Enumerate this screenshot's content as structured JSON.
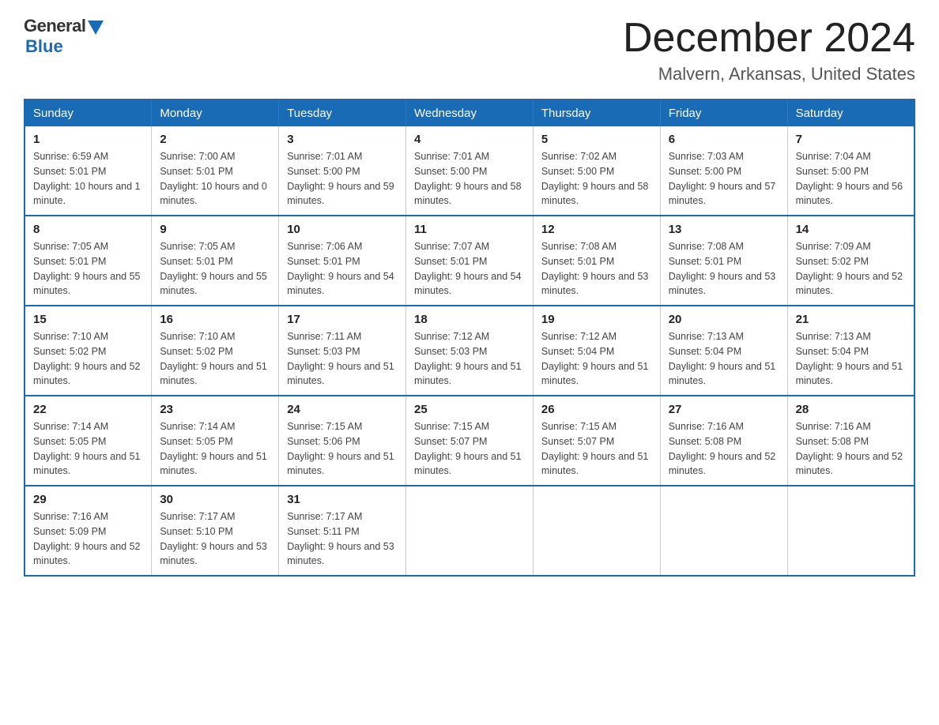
{
  "header": {
    "logo_general": "General",
    "logo_blue": "Blue",
    "month_title": "December 2024",
    "location": "Malvern, Arkansas, United States"
  },
  "days_of_week": [
    "Sunday",
    "Monday",
    "Tuesday",
    "Wednesday",
    "Thursday",
    "Friday",
    "Saturday"
  ],
  "weeks": [
    [
      {
        "day": "1",
        "sunrise": "6:59 AM",
        "sunset": "5:01 PM",
        "daylight": "10 hours and 1 minute."
      },
      {
        "day": "2",
        "sunrise": "7:00 AM",
        "sunset": "5:01 PM",
        "daylight": "10 hours and 0 minutes."
      },
      {
        "day": "3",
        "sunrise": "7:01 AM",
        "sunset": "5:00 PM",
        "daylight": "9 hours and 59 minutes."
      },
      {
        "day": "4",
        "sunrise": "7:01 AM",
        "sunset": "5:00 PM",
        "daylight": "9 hours and 58 minutes."
      },
      {
        "day": "5",
        "sunrise": "7:02 AM",
        "sunset": "5:00 PM",
        "daylight": "9 hours and 58 minutes."
      },
      {
        "day": "6",
        "sunrise": "7:03 AM",
        "sunset": "5:00 PM",
        "daylight": "9 hours and 57 minutes."
      },
      {
        "day": "7",
        "sunrise": "7:04 AM",
        "sunset": "5:00 PM",
        "daylight": "9 hours and 56 minutes."
      }
    ],
    [
      {
        "day": "8",
        "sunrise": "7:05 AM",
        "sunset": "5:01 PM",
        "daylight": "9 hours and 55 minutes."
      },
      {
        "day": "9",
        "sunrise": "7:05 AM",
        "sunset": "5:01 PM",
        "daylight": "9 hours and 55 minutes."
      },
      {
        "day": "10",
        "sunrise": "7:06 AM",
        "sunset": "5:01 PM",
        "daylight": "9 hours and 54 minutes."
      },
      {
        "day": "11",
        "sunrise": "7:07 AM",
        "sunset": "5:01 PM",
        "daylight": "9 hours and 54 minutes."
      },
      {
        "day": "12",
        "sunrise": "7:08 AM",
        "sunset": "5:01 PM",
        "daylight": "9 hours and 53 minutes."
      },
      {
        "day": "13",
        "sunrise": "7:08 AM",
        "sunset": "5:01 PM",
        "daylight": "9 hours and 53 minutes."
      },
      {
        "day": "14",
        "sunrise": "7:09 AM",
        "sunset": "5:02 PM",
        "daylight": "9 hours and 52 minutes."
      }
    ],
    [
      {
        "day": "15",
        "sunrise": "7:10 AM",
        "sunset": "5:02 PM",
        "daylight": "9 hours and 52 minutes."
      },
      {
        "day": "16",
        "sunrise": "7:10 AM",
        "sunset": "5:02 PM",
        "daylight": "9 hours and 51 minutes."
      },
      {
        "day": "17",
        "sunrise": "7:11 AM",
        "sunset": "5:03 PM",
        "daylight": "9 hours and 51 minutes."
      },
      {
        "day": "18",
        "sunrise": "7:12 AM",
        "sunset": "5:03 PM",
        "daylight": "9 hours and 51 minutes."
      },
      {
        "day": "19",
        "sunrise": "7:12 AM",
        "sunset": "5:04 PM",
        "daylight": "9 hours and 51 minutes."
      },
      {
        "day": "20",
        "sunrise": "7:13 AM",
        "sunset": "5:04 PM",
        "daylight": "9 hours and 51 minutes."
      },
      {
        "day": "21",
        "sunrise": "7:13 AM",
        "sunset": "5:04 PM",
        "daylight": "9 hours and 51 minutes."
      }
    ],
    [
      {
        "day": "22",
        "sunrise": "7:14 AM",
        "sunset": "5:05 PM",
        "daylight": "9 hours and 51 minutes."
      },
      {
        "day": "23",
        "sunrise": "7:14 AM",
        "sunset": "5:05 PM",
        "daylight": "9 hours and 51 minutes."
      },
      {
        "day": "24",
        "sunrise": "7:15 AM",
        "sunset": "5:06 PM",
        "daylight": "9 hours and 51 minutes."
      },
      {
        "day": "25",
        "sunrise": "7:15 AM",
        "sunset": "5:07 PM",
        "daylight": "9 hours and 51 minutes."
      },
      {
        "day": "26",
        "sunrise": "7:15 AM",
        "sunset": "5:07 PM",
        "daylight": "9 hours and 51 minutes."
      },
      {
        "day": "27",
        "sunrise": "7:16 AM",
        "sunset": "5:08 PM",
        "daylight": "9 hours and 52 minutes."
      },
      {
        "day": "28",
        "sunrise": "7:16 AM",
        "sunset": "5:08 PM",
        "daylight": "9 hours and 52 minutes."
      }
    ],
    [
      {
        "day": "29",
        "sunrise": "7:16 AM",
        "sunset": "5:09 PM",
        "daylight": "9 hours and 52 minutes."
      },
      {
        "day": "30",
        "sunrise": "7:17 AM",
        "sunset": "5:10 PM",
        "daylight": "9 hours and 53 minutes."
      },
      {
        "day": "31",
        "sunrise": "7:17 AM",
        "sunset": "5:11 PM",
        "daylight": "9 hours and 53 minutes."
      },
      null,
      null,
      null,
      null
    ]
  ]
}
